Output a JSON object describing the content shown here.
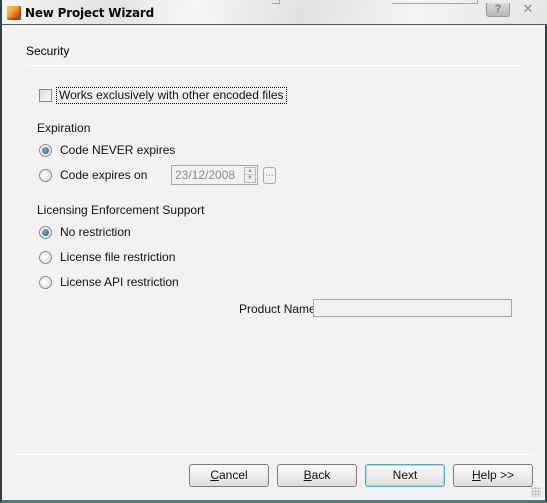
{
  "window": {
    "title": "New Project Wizard",
    "help_icon": "question-mark-icon",
    "close_icon": "close-x-icon",
    "app_icon": "app-cube-icon"
  },
  "page": {
    "section_title": "Security",
    "encoded_checkbox": {
      "label": "Works exclusively with other encoded files",
      "checked": false,
      "focused": true
    },
    "expiration": {
      "label": "Expiration",
      "options": [
        {
          "label": "Code NEVER expires",
          "checked": true
        },
        {
          "label": "Code expires on",
          "checked": false
        }
      ],
      "date_value": "23/12/2008",
      "date_enabled": false,
      "browse_button_label": "..."
    },
    "licensing": {
      "label": "Licensing Enforcement Support",
      "options": [
        {
          "label": "No restriction",
          "checked": true
        },
        {
          "label": "License file restriction",
          "checked": false
        },
        {
          "label": "License API restriction",
          "checked": false
        }
      ],
      "product_name_label": "Product Name",
      "product_name_value": ""
    }
  },
  "buttons": {
    "cancel": {
      "prefix": "",
      "accel": "C",
      "rest": "ancel"
    },
    "back": {
      "prefix": "",
      "accel": "B",
      "rest": "ack"
    },
    "next": {
      "label": "Next"
    },
    "help": {
      "prefix": "",
      "accel": "H",
      "rest": "elp >>"
    }
  }
}
